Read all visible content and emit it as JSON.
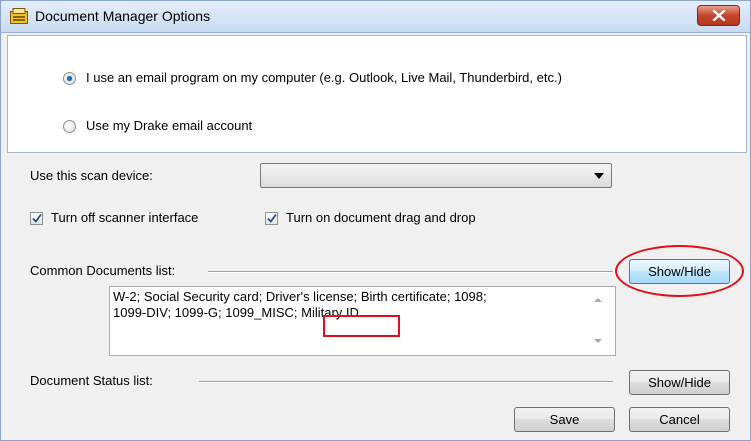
{
  "window": {
    "title": "Document Manager Options",
    "icon": "document-manager-icon",
    "close_icon": "close-icon"
  },
  "email": {
    "option_1": "I use an email program on my computer (e.g. Outlook, Live Mail, Thunderbird, etc.)",
    "option_2": "Use my Drake email account",
    "selected": "option_1"
  },
  "scan": {
    "label": "Use this scan device:",
    "value": ""
  },
  "checkboxes": {
    "scanner_interface": "Turn off scanner interface",
    "drag_drop": "Turn on document drag and drop",
    "scanner_interface_checked": true,
    "drag_drop_checked": true
  },
  "common_docs": {
    "label": "Common Documents list:",
    "show_hide": "Show/Hide",
    "text_line1": "W-2; Social Security card; Driver's license; Birth certificate; 1098;",
    "text_line2a": "1099-DIV; 1099-G; 1099_MISC;",
    "text_line2b": "Military ID"
  },
  "status_docs": {
    "label": "Document Status list:",
    "show_hide": "Show/Hide"
  },
  "footer": {
    "save": "Save",
    "cancel": "Cancel"
  },
  "colors": {
    "highlight": "#e0101a",
    "titlebar": "#c9dbf1"
  }
}
